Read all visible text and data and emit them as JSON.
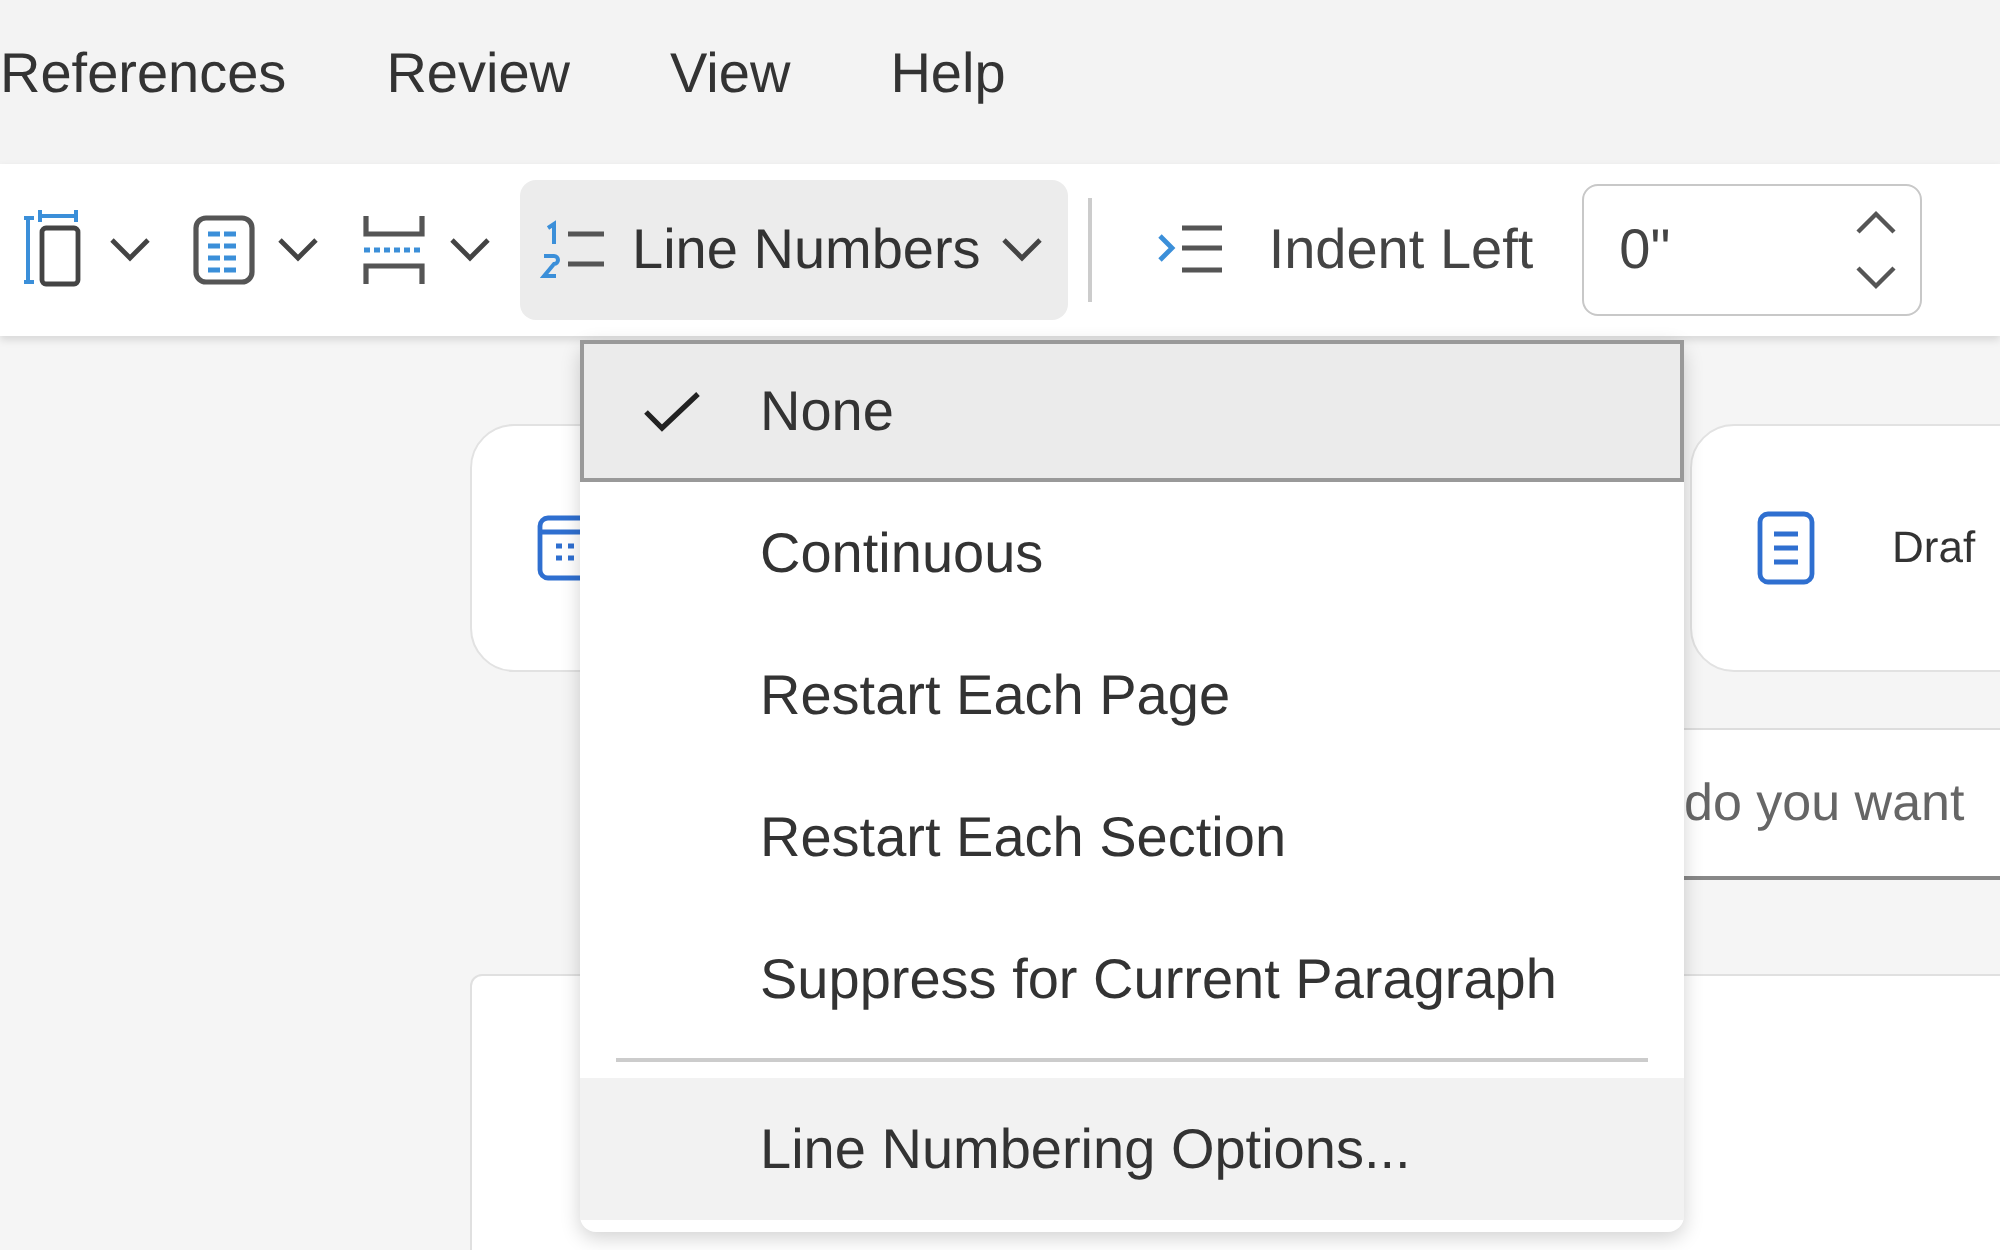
{
  "menu_bar": [
    {
      "label": "References"
    },
    {
      "label": "Review"
    },
    {
      "label": "View"
    },
    {
      "label": "Help"
    }
  ],
  "toolbar": {
    "icon_buttons": [
      {
        "kind": "margins"
      },
      {
        "kind": "table"
      },
      {
        "kind": "break"
      }
    ],
    "line_numbers": {
      "label": "Line Numbers",
      "expanded": true
    },
    "indent_left": {
      "label": "Indent Left",
      "value": "0\""
    }
  },
  "cards": [
    {
      "kind": "table"
    },
    {
      "kind": "document",
      "label": "Draf"
    }
  ],
  "search": {
    "placeholder": "do you want"
  },
  "dropdown": {
    "items": [
      {
        "label": "None",
        "checked": true,
        "selected": true
      },
      {
        "label": "Continuous",
        "checked": false,
        "selected": false
      },
      {
        "label": "Restart Each Page",
        "checked": false,
        "selected": false
      },
      {
        "label": "Restart Each Section",
        "checked": false,
        "selected": false
      },
      {
        "label": "Suppress for Current Paragraph",
        "checked": false,
        "selected": false
      }
    ],
    "footer": {
      "label": "Line Numbering Options...",
      "hovered": true
    }
  }
}
